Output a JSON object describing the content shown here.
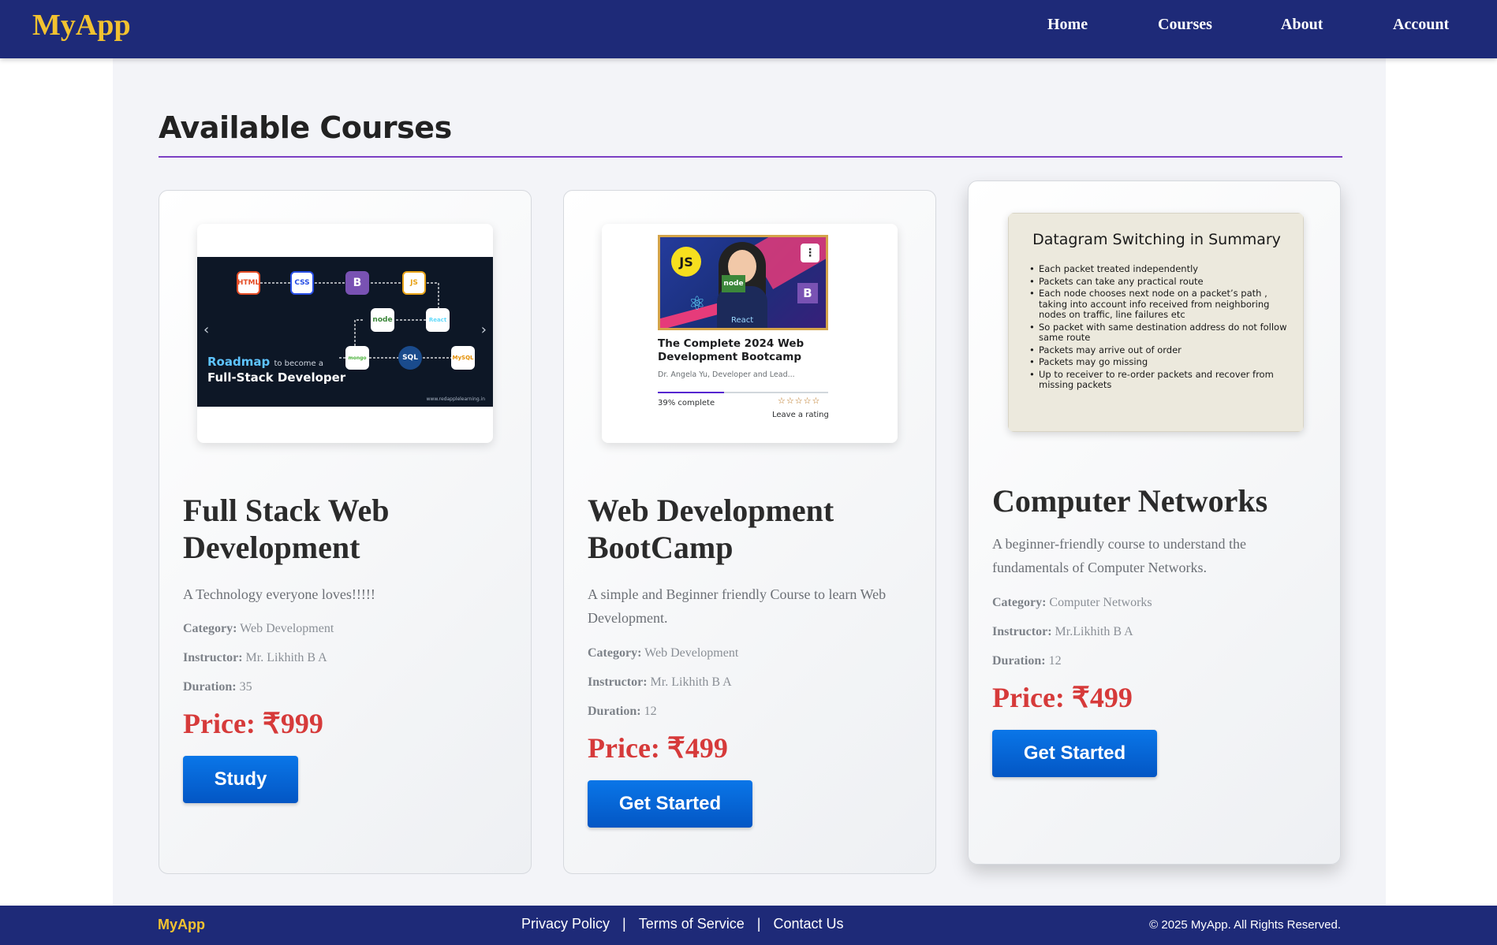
{
  "navbar": {
    "brand": "MyApp",
    "links": [
      "Home",
      "Courses",
      "About",
      "Account"
    ]
  },
  "main": {
    "heading": "Available Courses",
    "courses": [
      {
        "title_line1": "Full Stack Web",
        "title_line2": "Development",
        "description": "A Technology everyone loves!!!!!",
        "category_label": "Category:",
        "category": "Web Development",
        "instructor_label": "Instructor:",
        "instructor": "Mr. Likhith B A",
        "duration_label": "Duration:",
        "duration": "35",
        "price": "Price: ₹999",
        "button": "Study",
        "thumbnail": {
          "nodes": [
            "HTML",
            "CSS",
            "B",
            "JS",
            "node",
            "React",
            "mongo",
            "SQL",
            "MySQL"
          ],
          "line1": "Roadmap",
          "line1_small": "to become a",
          "line2": "Full-Stack Developer",
          "url": "www.redapplelearning.in"
        }
      },
      {
        "title_line1": "Web Development",
        "title_line2": "BootCamp",
        "description": "A simple and Beginner friendly Course to learn Web Development.",
        "category_label": "Category:",
        "category": "Web Development",
        "instructor_label": "Instructor:",
        "instructor": "Mr. Likhith B A",
        "duration_label": "Duration:",
        "duration": "12",
        "price": "Price: ₹499",
        "button": "Get Started",
        "thumbnail": {
          "title": "The Complete 2024 Web Development Bootcamp",
          "author": "Dr. Angela Yu, Developer and Lead...",
          "progress_text": "39% complete",
          "progress": 0.39,
          "stars": "☆☆☆☆☆",
          "rating_text": "Leave a rating",
          "badge_js": "JS",
          "badge_node": "node",
          "badge_b": "B",
          "badge_react": "React"
        }
      },
      {
        "title_line1": "Computer Networks",
        "title_line2": "",
        "description": "A beginner-friendly course to understand the fundamentals of Computer Networks.",
        "category_label": "Category:",
        "category": "Computer Networks",
        "instructor_label": "Instructor:",
        "instructor": "Mr.Likhith B A",
        "duration_label": "Duration:",
        "duration": "12",
        "price": "Price: ₹499",
        "button": "Get Started",
        "thumbnail": {
          "title": "Datagram Switching in Summary",
          "bullets": [
            "Each packet treated independently",
            "Packets can take any practical route",
            "Each node chooses next node on a packet’s path , taking into account info received from neighboring nodes on traffic, line failures etc",
            "So packet with same destination address  do not follow same route",
            "Packets may arrive out of order",
            "Packets may go missing",
            "Up to receiver to re-order packets and recover from missing packets"
          ]
        }
      }
    ]
  },
  "footer": {
    "brand": "MyApp",
    "links": [
      "Privacy Policy",
      "Terms of Service",
      "Contact Us"
    ],
    "separator": "|",
    "copyright": "© 2025 MyApp. All Rights Reserved."
  }
}
